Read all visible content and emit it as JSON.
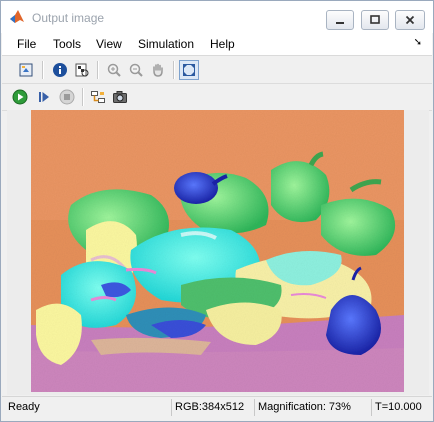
{
  "window": {
    "title": "Output image",
    "controls": {
      "minimize": "minimize",
      "maximize": "maximize",
      "close": "close"
    }
  },
  "menu": {
    "items": [
      {
        "label": "File"
      },
      {
        "label": "Tools"
      },
      {
        "label": "View"
      },
      {
        "label": "Simulation"
      },
      {
        "label": "Help"
      }
    ]
  },
  "toolbar1": {
    "buttons": [
      "print-to-figure-icon",
      "info-icon",
      "pixel-region-icon",
      "zoom-in-icon",
      "zoom-out-icon",
      "pan-hand-icon",
      "fit-to-window-icon"
    ],
    "pressed": "fit-to-window-icon"
  },
  "toolbar2": {
    "buttons": [
      "run-icon",
      "step-forward-icon",
      "stop-icon",
      "highlight-model-icon",
      "snapshot-icon"
    ]
  },
  "status": {
    "state": "Ready",
    "rgb": "RGB:384x512",
    "magnification": "Magnification: 73%",
    "time": "T=10.000"
  },
  "colors": {
    "background_orange": "#e6905a",
    "table_purple": "#c87fbe",
    "foreground_cyan": "#3dfde0",
    "foreground_green": "#52d873",
    "foreground_blue": "#2b3fd6",
    "foreground_yellow": "#fbf7a0"
  }
}
